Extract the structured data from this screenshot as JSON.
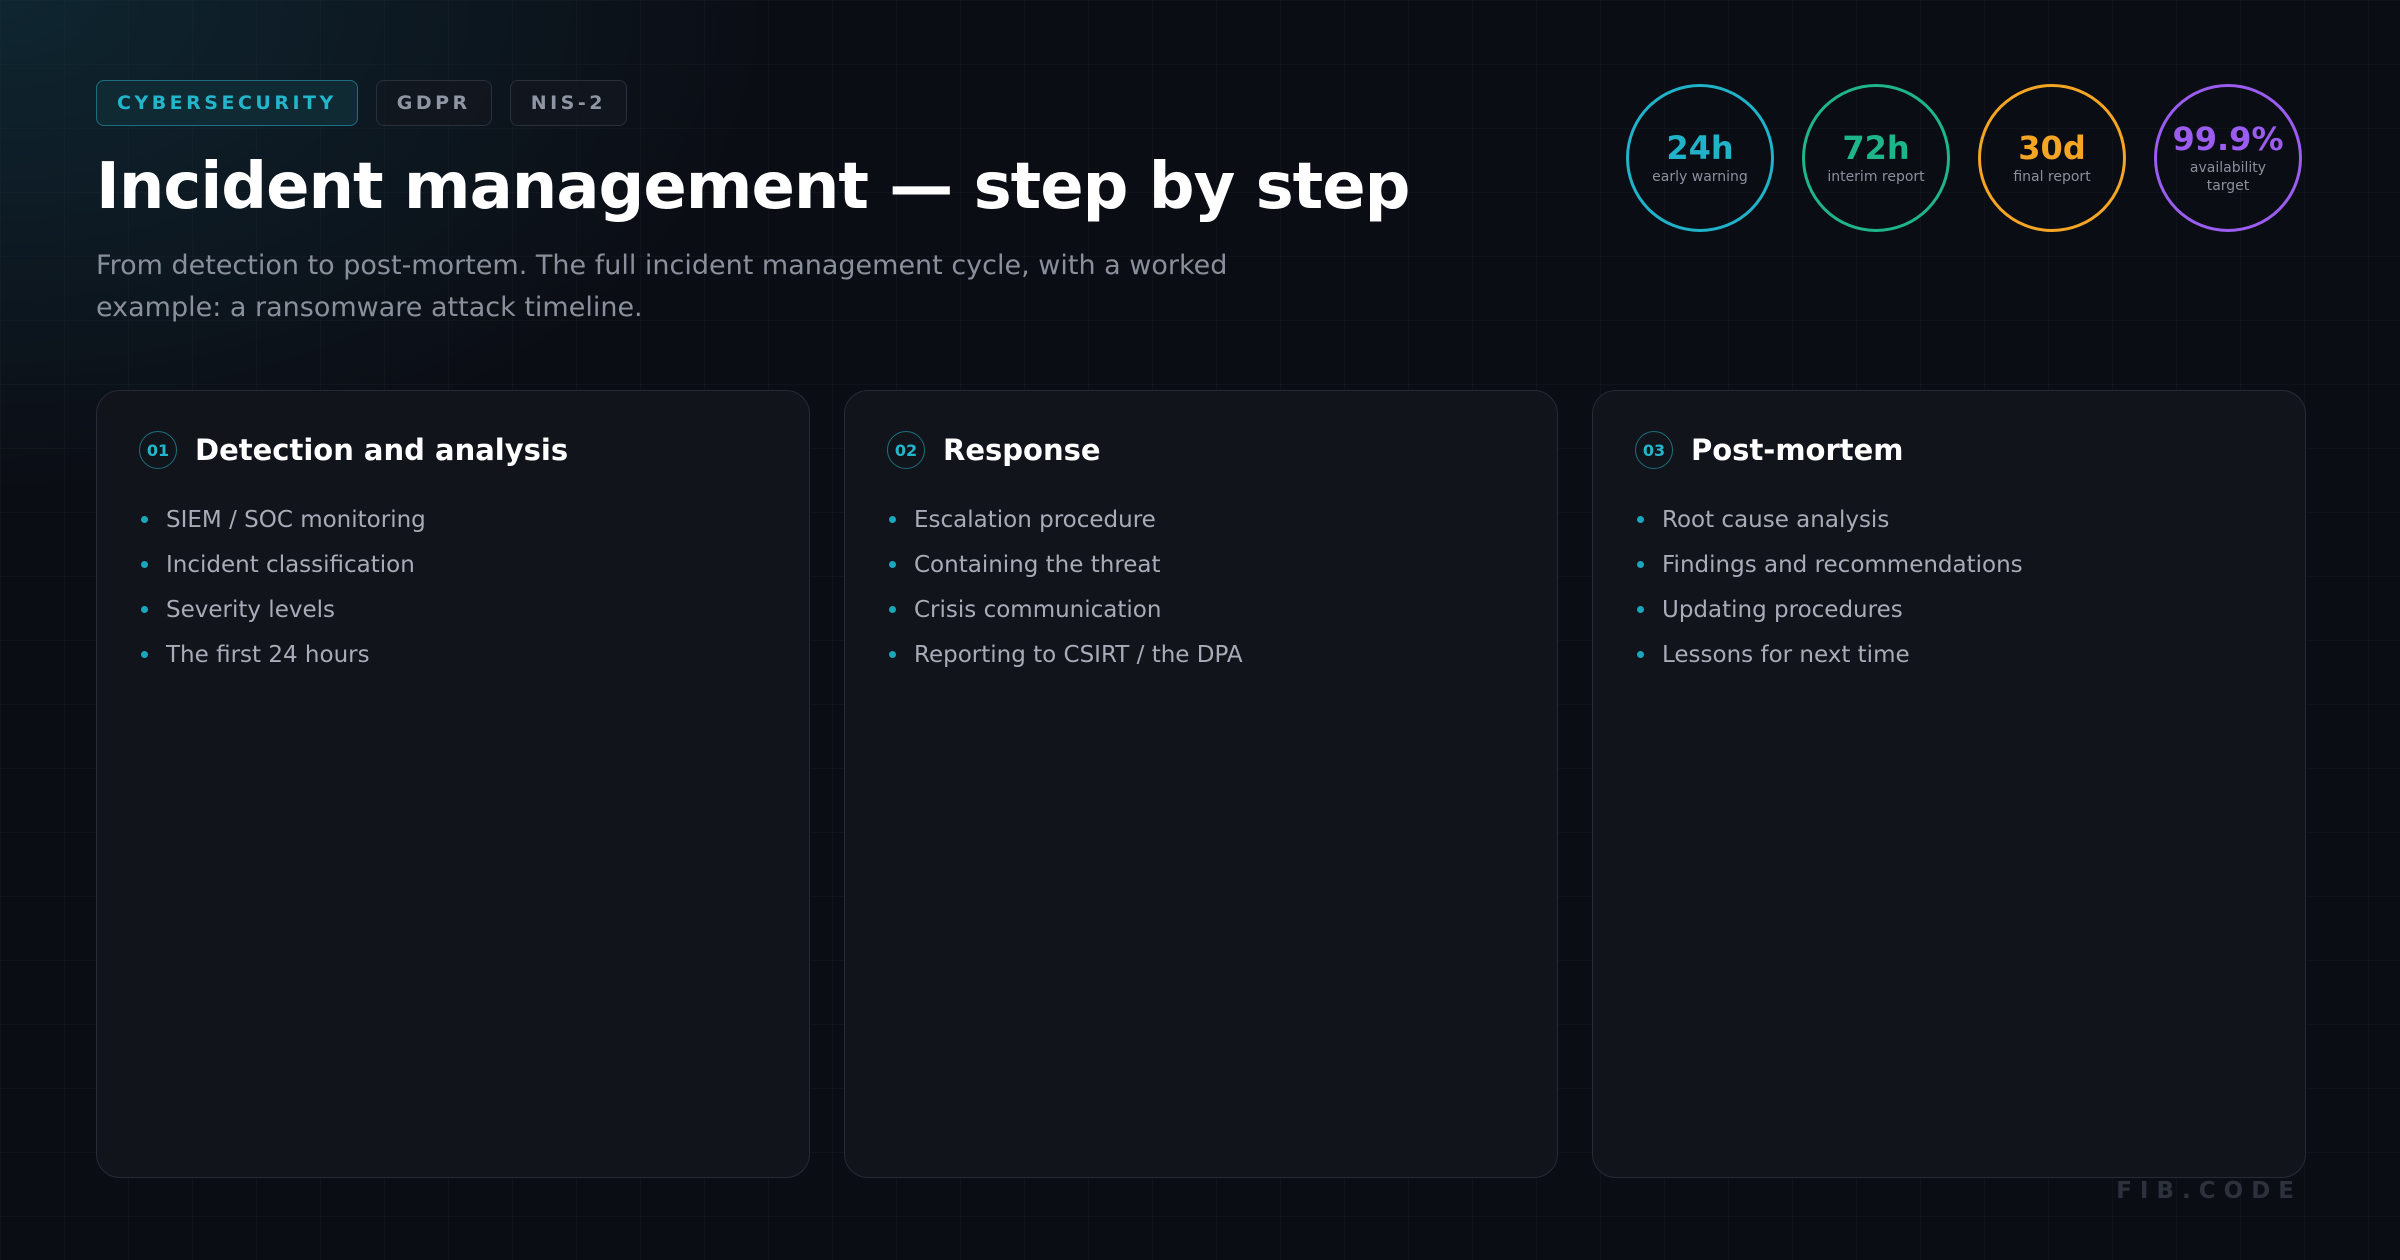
{
  "tags": [
    "CYBERSECURITY",
    "GDPR",
    "NIS-2"
  ],
  "title": "Incident management — step by step",
  "subtitle": "From detection to post-mortem. The full incident management cycle, with a worked example: a ransomware attack timeline.",
  "stats": [
    {
      "value": "24h",
      "label": "early warning",
      "color": "#1fb2c8"
    },
    {
      "value": "72h",
      "label": "interim report",
      "color": "#1fb58b"
    },
    {
      "value": "30d",
      "label": "final report",
      "color": "#f5a524"
    },
    {
      "value": "99.9%",
      "label": "availability target",
      "color": "#9b5cf0"
    }
  ],
  "cards": [
    {
      "num": "01",
      "title": "Detection and analysis",
      "items": [
        "SIEM / SOC monitoring",
        "Incident classification",
        "Severity levels",
        "The first 24 hours"
      ]
    },
    {
      "num": "02",
      "title": "Response",
      "items": [
        "Escalation procedure",
        "Containing the threat",
        "Crisis communication",
        "Reporting to CSIRT / the DPA"
      ]
    },
    {
      "num": "03",
      "title": "Post-mortem",
      "items": [
        "Root cause analysis",
        "Findings and recommendations",
        "Updating procedures",
        "Lessons for next time"
      ]
    }
  ],
  "brand": "FIB.CODE",
  "colors": {
    "accent": "#22b5cc",
    "background": "#0b0d14",
    "card": "#12141b"
  }
}
